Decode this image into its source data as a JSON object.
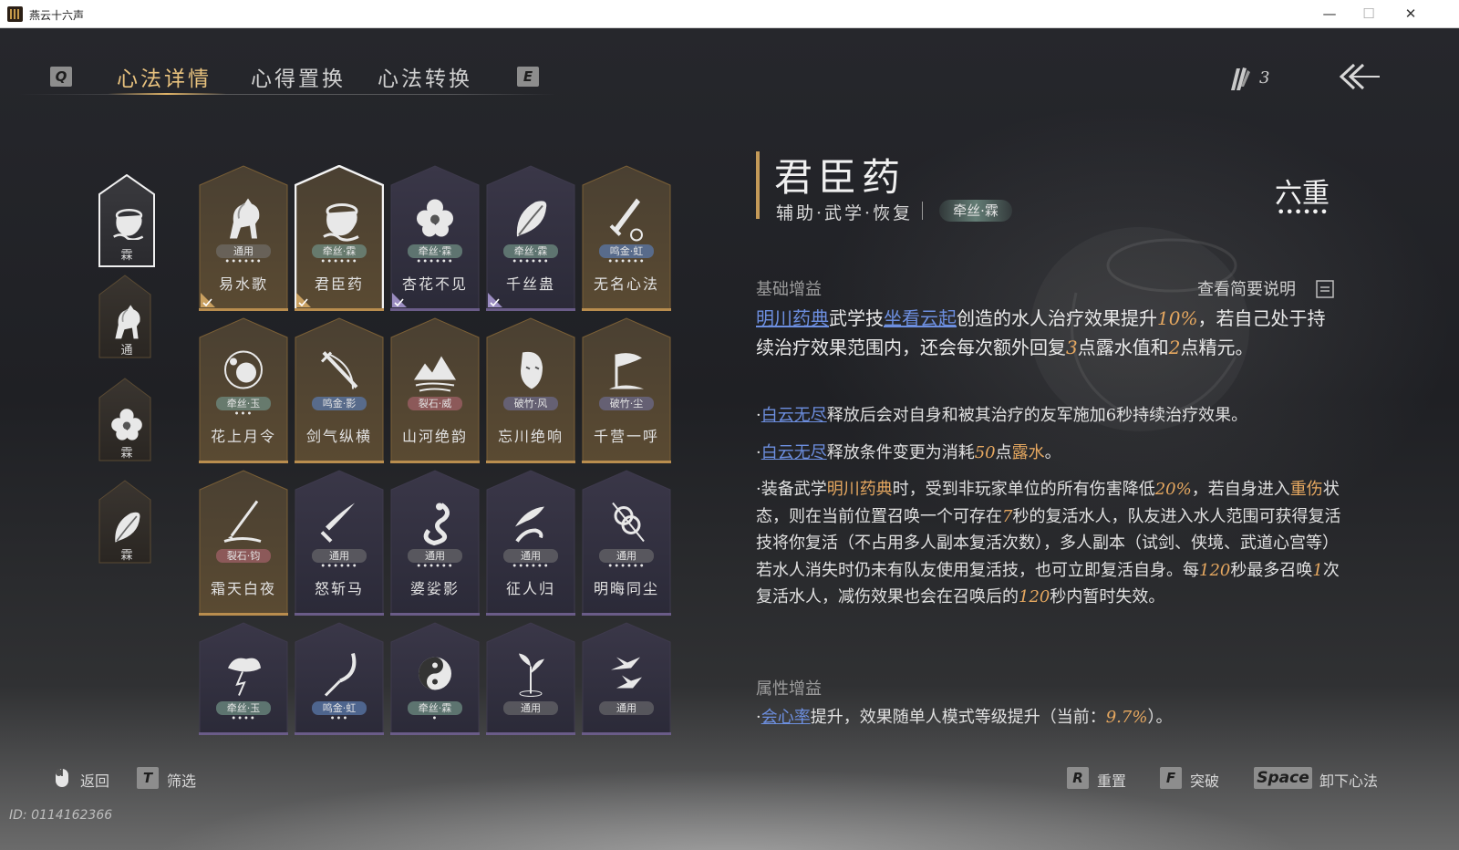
{
  "window": {
    "title": "燕云十六声"
  },
  "tabs": {
    "prev_key": "Q",
    "next_key": "E",
    "items": [
      {
        "label": "心法详情",
        "active": true
      },
      {
        "label": "心得置换",
        "active": false
      },
      {
        "label": "心法转换",
        "active": false
      }
    ]
  },
  "currency": {
    "icon": "feather-quill-icon",
    "count": "3"
  },
  "back_icon": "back-arrow-icon",
  "equipped": [
    {
      "label": "霖",
      "selected": true
    },
    {
      "label": "通",
      "selected": false
    },
    {
      "label": "霖",
      "selected": false
    },
    {
      "label": "霖",
      "selected": false
    }
  ],
  "cards": [
    {
      "name": "易水歌",
      "badge": "通用",
      "dots": "••••••",
      "icon": "horse-icon",
      "equipped": true,
      "style": "gold"
    },
    {
      "name": "君臣药",
      "badge": "牵丝·霖",
      "dots": "••••••",
      "icon": "pot-icon",
      "equipped": true,
      "style": "gold",
      "selected": true
    },
    {
      "name": "杏花不见",
      "badge": "牵丝·霖",
      "dots": "••••••",
      "icon": "flower-icon",
      "equipped": true,
      "style": "purple"
    },
    {
      "name": "千丝蛊",
      "badge": "牵丝·霖",
      "dots": "••••••",
      "icon": "leaf-icon",
      "equipped": true,
      "style": "purple"
    },
    {
      "name": "无名心法",
      "badge": "鸣金·虹",
      "dots": "••••••",
      "icon": "sword-icon",
      "equipped": false,
      "style": "gold"
    },
    {
      "name": "花上月令",
      "badge": "牵丝·玉",
      "dots": "•••",
      "icon": "moon-flower-icon",
      "equipped": false,
      "style": "gold"
    },
    {
      "name": "剑气纵横",
      "badge": "鸣金·影",
      "dots": "",
      "icon": "crossed-swords-icon",
      "equipped": false,
      "style": "gold"
    },
    {
      "name": "山河绝韵",
      "badge": "裂石·威",
      "dots": "",
      "icon": "mountain-icon",
      "equipped": false,
      "style": "gold"
    },
    {
      "name": "忘川绝响",
      "badge": "破竹·风",
      "dots": "",
      "icon": "mask-icon",
      "equipped": false,
      "style": "gold"
    },
    {
      "name": "千营一呼",
      "badge": "破竹·尘",
      "dots": "",
      "icon": "flag-icon",
      "equipped": false,
      "style": "gold"
    },
    {
      "name": "霜天白夜",
      "badge": "裂石·钧",
      "dots": "",
      "icon": "spear-icon",
      "equipped": false,
      "style": "gold"
    },
    {
      "name": "怒斩马",
      "badge": "通用",
      "dots": "••••••",
      "icon": "blade-icon",
      "equipped": false,
      "style": "purple"
    },
    {
      "name": "婆娑影",
      "badge": "通用",
      "dots": "••••••",
      "icon": "dragon-icon",
      "equipped": false,
      "style": "purple"
    },
    {
      "name": "征人归",
      "badge": "通用",
      "dots": "••••••",
      "icon": "bird-hand-icon",
      "equipped": false,
      "style": "purple"
    },
    {
      "name": "明晦同尘",
      "badge": "通用",
      "dots": "••••••",
      "icon": "knot-icon",
      "equipped": false,
      "style": "purple"
    },
    {
      "name": "",
      "badge": "牵丝·玉",
      "dots": "••••",
      "icon": "storm-icon",
      "equipped": false,
      "style": "purple"
    },
    {
      "name": "",
      "badge": "鸣金·虹",
      "dots": "•••",
      "icon": "scythe-icon",
      "equipped": false,
      "style": "purple"
    },
    {
      "name": "",
      "badge": "牵丝·霖",
      "dots": "•",
      "icon": "yin-yang-icon",
      "equipped": false,
      "style": "purple"
    },
    {
      "name": "",
      "badge": "通用",
      "dots": "",
      "icon": "sprout-icon",
      "equipped": false,
      "style": "purple"
    },
    {
      "name": "",
      "badge": "通用",
      "dots": "",
      "icon": "swallows-icon",
      "equipped": false,
      "style": "purple"
    }
  ],
  "detail": {
    "title": "君臣药",
    "subtitle": "辅助·武学·恢复",
    "tag": "牵丝·霖",
    "rank": "六重",
    "rank_dots": "••••••",
    "basic_section": "基础增益",
    "view_brief": "查看简要说明",
    "main": {
      "hl1": "明川药典",
      "t1": "武学技",
      "hl2": "坐看云起",
      "t2": "创造的水人治疗效果提升",
      "n1": "10%",
      "t3": "，若自己处于持续治疗效果范围内，还会每次额外回复",
      "n2": "3",
      "t4": "点露水值和",
      "n3": "2",
      "t5": "点精元。"
    },
    "b1": {
      "pre": "·",
      "hl": "白云无尽",
      "text": "释放后会对自身和被其治疗的友军施加6秒持续治疗效果。"
    },
    "b2": {
      "pre": "·",
      "hl": "白云无尽",
      "t1": "释放条件变更为消耗",
      "n": "50",
      "t2": "点",
      "or": "露水",
      "t3": "。"
    },
    "b3": {
      "t1": "·装备武学",
      "or1": "明川药典",
      "t2": "时，受到非玩家单位的所有伤害降低",
      "n1": "20%",
      "t3": "，若自身进入",
      "or2": "重伤",
      "t4": "状态，则在当前位置召唤一个可存在",
      "n2": "7",
      "t5": "秒的复活水人，队友进入水人范围可获得复活技将你复活（不占用多人副本复活次数），多人副本（试剑、侠境、武道心宫等）若水人消失时仍未有队友使用复活技，也可立即复活自身。每",
      "n3": "120",
      "t6": "秒最多召唤",
      "n4": "1",
      "t7": "次复活水人，减伤效果也会在召唤后的",
      "n5": "120",
      "t8": "秒内暂时失效。"
    },
    "attr_section": "属性增益",
    "attr": {
      "pre": "·",
      "hl": "会心率",
      "t1": "提升，效果随单人模式等级提升（当前：",
      "n": "9.7%",
      "t2": "）。"
    }
  },
  "hints": {
    "back": "返回",
    "filter_key": "T",
    "filter": "筛选",
    "reset_key": "R",
    "reset": "重置",
    "break_key": "F",
    "break": "突破",
    "unload_key": "Space",
    "unload": "卸下心法"
  },
  "player_id": "ID: 0114162366",
  "colors": {
    "gold": "#c9a060",
    "accent": "#e8c27e",
    "link": "#6d8fe0",
    "number": "#e6a860"
  }
}
